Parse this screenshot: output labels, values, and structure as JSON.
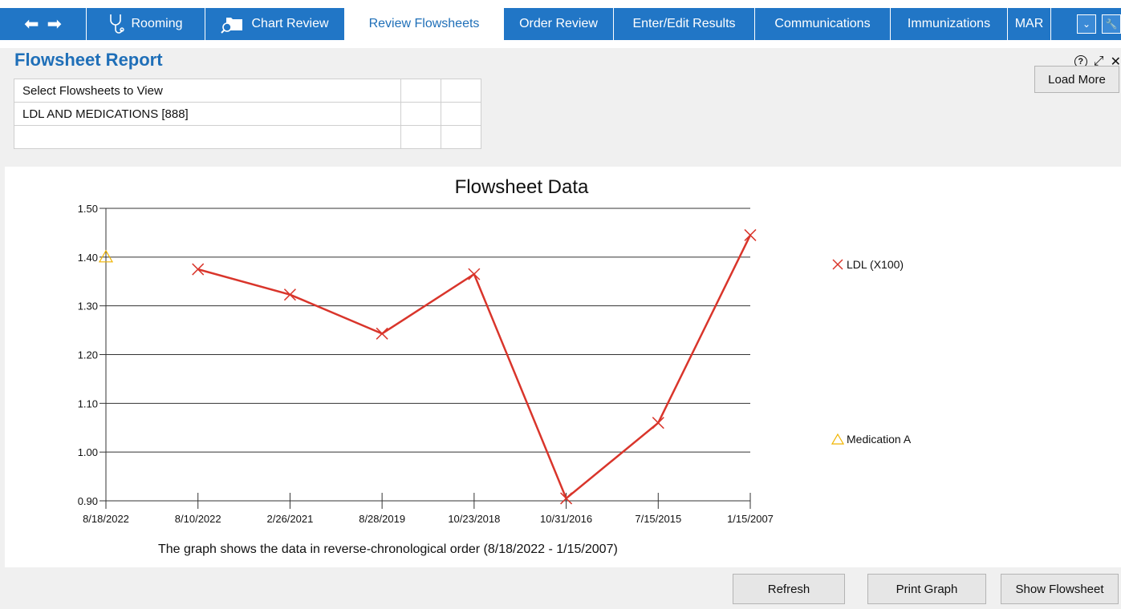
{
  "tabs": [
    {
      "label": "Rooming",
      "icon": "stethoscope-icon"
    },
    {
      "label": "Chart Review",
      "icon": "folder-search-icon"
    },
    {
      "label": "Review Flowsheets",
      "active": true
    },
    {
      "label": "Order Review"
    },
    {
      "label": "Enter/Edit Results"
    },
    {
      "label": "Communications"
    },
    {
      "label": "Immunizations"
    },
    {
      "label": "MAR"
    }
  ],
  "nav": {
    "back_icon": "back-arrow-icon",
    "forward_icon": "forward-arrow-icon"
  },
  "page": {
    "title": "Flowsheet Report"
  },
  "flowsheet_select": {
    "header": "Select Flowsheets to View",
    "rows": [
      "LDL AND MEDICATIONS [888]",
      ""
    ]
  },
  "buttons": {
    "load_more": "Load More",
    "refresh": "Refresh",
    "print_graph": "Print Graph",
    "show_flowsheet": "Show Flowsheet"
  },
  "chart_data": {
    "type": "line",
    "title": "Flowsheet Data",
    "categories": [
      "8/18/2022",
      "8/10/2022",
      "2/26/2021",
      "8/28/2019",
      "10/23/2018",
      "10/31/2016",
      "7/15/2015",
      "1/15/2007"
    ],
    "ylim": [
      0.9,
      1.5
    ],
    "yticks": [
      "0.90",
      "1.00",
      "1.10",
      "1.20",
      "1.30",
      "1.40",
      "1.50"
    ],
    "grid": true,
    "legend_position": "right",
    "series": [
      {
        "name": "LDL (X100)",
        "marker": "x",
        "color": "#d9352b",
        "values": [
          null,
          1.375,
          1.323,
          1.243,
          1.365,
          0.905,
          1.06,
          1.445
        ]
      },
      {
        "name": "Medication A",
        "marker": "triangle",
        "color": "#f0b400",
        "values": [
          1.4,
          null,
          null,
          null,
          null,
          null,
          null,
          null
        ]
      }
    ],
    "caption": "The graph shows the data in reverse-chronological order (8/18/2022 - 1/15/2007)"
  }
}
